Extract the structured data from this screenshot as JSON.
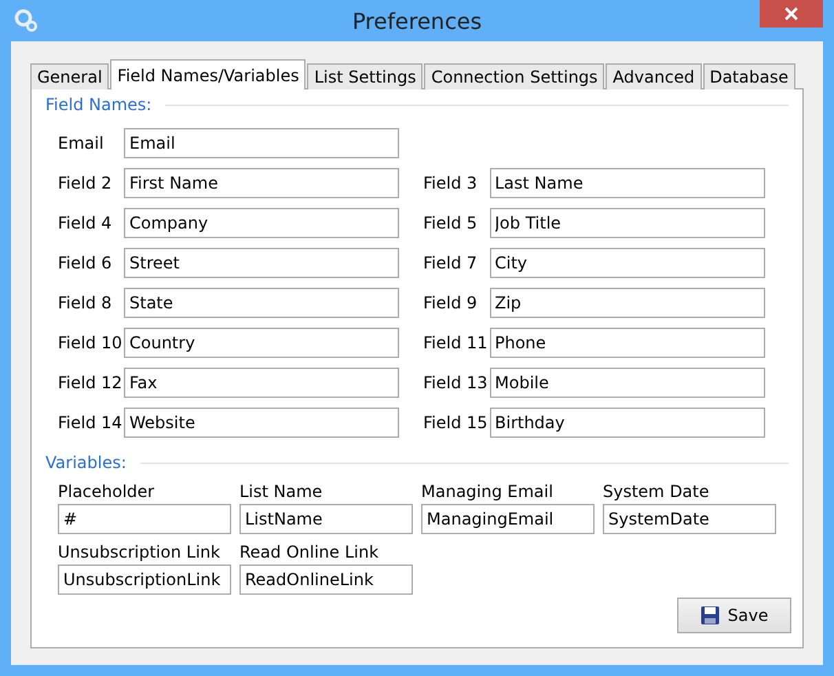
{
  "window": {
    "title": "Preferences"
  },
  "tabs": [
    {
      "label": "General",
      "selected": false
    },
    {
      "label": "Field Names/Variables",
      "selected": true
    },
    {
      "label": "List Settings",
      "selected": false
    },
    {
      "label": "Connection Settings",
      "selected": false
    },
    {
      "label": "Advanced",
      "selected": false
    },
    {
      "label": "Database",
      "selected": false
    }
  ],
  "field_names": {
    "title": "Field Names:",
    "rows": [
      [
        {
          "label": "Email",
          "value": "Email"
        }
      ],
      [
        {
          "label": "Field 2",
          "value": "First Name"
        },
        {
          "label": "Field 3",
          "value": "Last Name"
        }
      ],
      [
        {
          "label": "Field 4",
          "value": "Company"
        },
        {
          "label": "Field 5",
          "value": "Job Title"
        }
      ],
      [
        {
          "label": "Field 6",
          "value": "Street"
        },
        {
          "label": "Field 7",
          "value": "City"
        }
      ],
      [
        {
          "label": "Field 8",
          "value": "State"
        },
        {
          "label": "Field 9",
          "value": "Zip"
        }
      ],
      [
        {
          "label": "Field 10",
          "value": "Country"
        },
        {
          "label": "Field 11",
          "value": "Phone"
        }
      ],
      [
        {
          "label": "Field 12",
          "value": "Fax"
        },
        {
          "label": "Field 13",
          "value": "Mobile"
        }
      ],
      [
        {
          "label": "Field 14",
          "value": "Website"
        },
        {
          "label": "Field 15",
          "value": "Birthday"
        }
      ]
    ]
  },
  "variables": {
    "title": "Variables:",
    "items": [
      {
        "label": "Placeholder",
        "value": "#"
      },
      {
        "label": "List Name",
        "value": "ListName"
      },
      {
        "label": "Managing Email",
        "value": "ManagingEmail"
      },
      {
        "label": "System Date",
        "value": "SystemDate"
      },
      {
        "label": "Unsubscription Link",
        "value": "UnsubscriptionLink"
      },
      {
        "label": "Read Online Link",
        "value": "ReadOnlineLink"
      }
    ]
  },
  "save_button": {
    "label": "Save"
  }
}
